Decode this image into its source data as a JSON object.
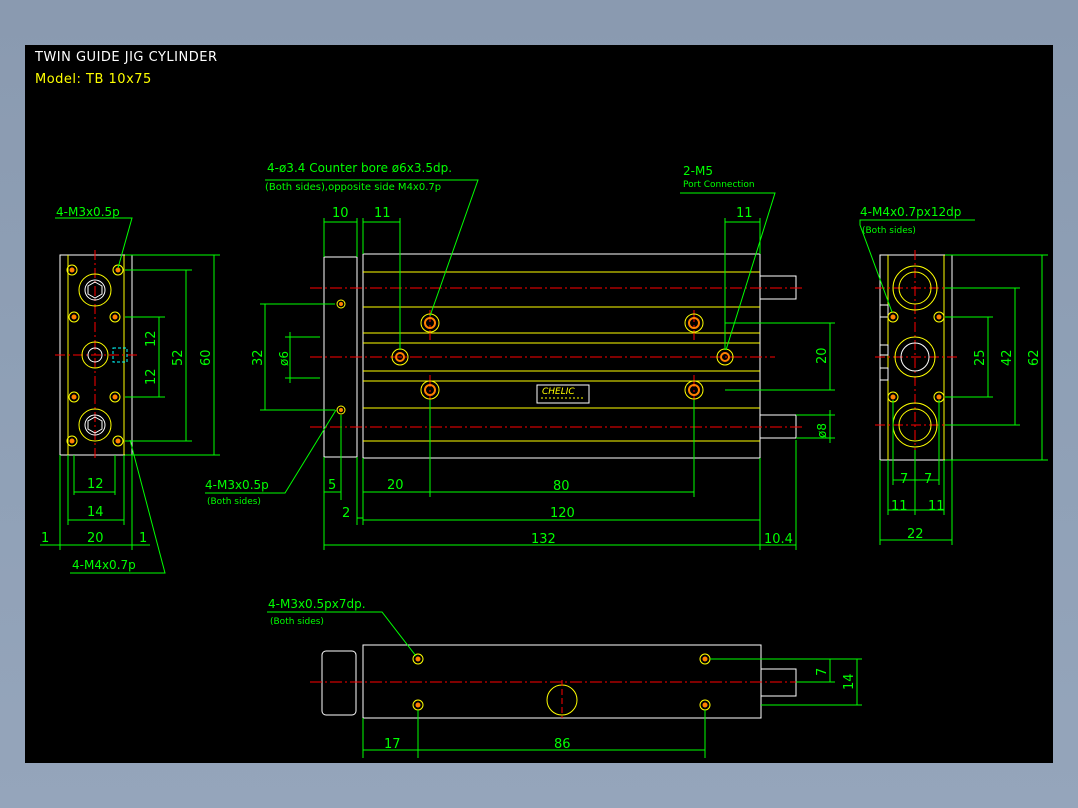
{
  "header": {
    "title": "TWIN GUIDE JIG CYLINDER",
    "model": "Model: TB 10x75"
  },
  "colors": {
    "background": "#000000",
    "outline": "#ffffff",
    "body_lines": "#ffff00",
    "dimension": "#00ff00",
    "center_line": "#ff0000",
    "hole": "#ff8000"
  },
  "notes": {
    "counter_bore_line1": "4-ø3.4 Counter bore ø6x3.5dp.",
    "counter_bore_line2": "(Both sides),opposite side M4x0.7p",
    "port_line1": "2-M5",
    "port_line2": "Port Connection",
    "left_top_thread": "4-M3x0.5p",
    "left_bottom_thread": "4-M4x0.7p",
    "mid_thread_line1": "4-M3x0.5p",
    "mid_thread_line2": "(Both sides)",
    "right_thread_line1": "4-M4x0.7px12dp",
    "right_thread_line2": "(Both sides)",
    "bottom_thread_line1": "4-M3x0.5px7dp.",
    "bottom_thread_line2": "(Both sides)",
    "logo": "CHELIC"
  },
  "dims": {
    "left": {
      "d12a": "12",
      "d12b": "12",
      "d52": "52",
      "d60": "60",
      "d12w": "12",
      "d14": "14",
      "d20": "20",
      "d1a": "1",
      "d1b": "1"
    },
    "front": {
      "d10": "10",
      "d11a": "11",
      "d11b": "11",
      "d32": "32",
      "d6": "ø6",
      "d20v": "20",
      "d8": "ø8",
      "d5": "5",
      "d2": "2",
      "d20h": "20",
      "d80": "80",
      "d120": "120",
      "d132": "132",
      "d104": "10.4"
    },
    "right": {
      "d25": "25",
      "d42": "42",
      "d62": "62",
      "d7a": "7",
      "d7b": "7",
      "d11a": "11",
      "d11b": "11",
      "d22": "22"
    },
    "bottom": {
      "d7": "7",
      "d14": "14",
      "d17": "17",
      "d86": "86"
    }
  }
}
